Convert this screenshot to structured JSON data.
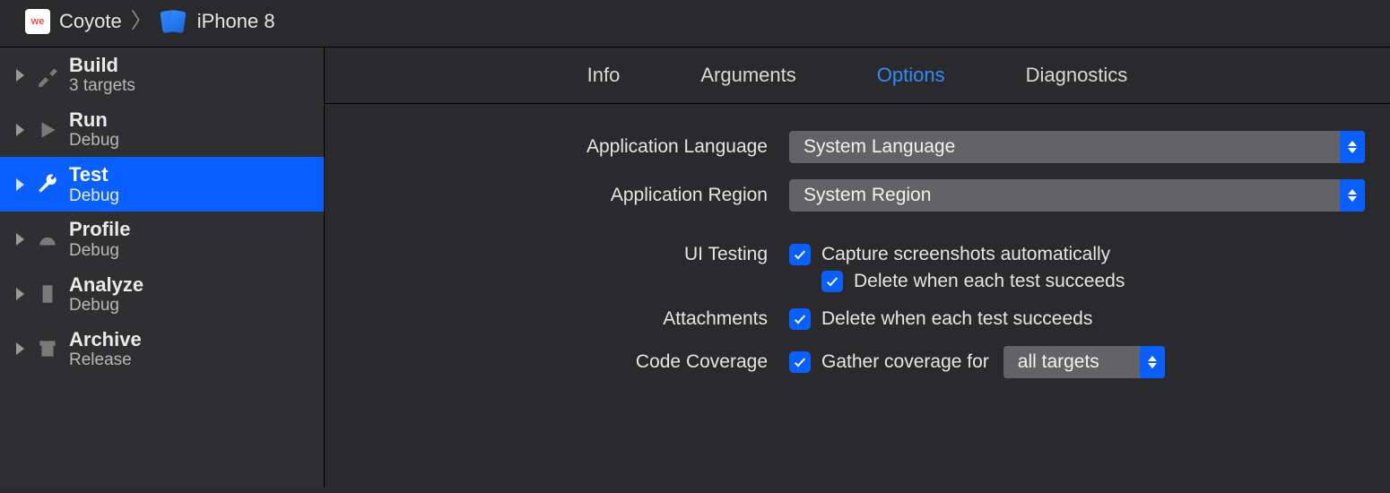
{
  "breadcrumb": {
    "project": "Coyote",
    "device": "iPhone 8"
  },
  "sidebar": {
    "items": [
      {
        "title": "Build",
        "sub": "3 targets"
      },
      {
        "title": "Run",
        "sub": "Debug"
      },
      {
        "title": "Test",
        "sub": "Debug"
      },
      {
        "title": "Profile",
        "sub": "Debug"
      },
      {
        "title": "Analyze",
        "sub": "Debug"
      },
      {
        "title": "Archive",
        "sub": "Release"
      }
    ]
  },
  "tabs": {
    "info": "Info",
    "arguments": "Arguments",
    "options": "Options",
    "diagnostics": "Diagnostics"
  },
  "options": {
    "language_label": "Application Language",
    "language_value": "System Language",
    "region_label": "Application Region",
    "region_value": "System Region",
    "uitesting_label": "UI Testing",
    "uitesting_capture": "Capture screenshots automatically",
    "uitesting_delete": "Delete when each test succeeds",
    "attachments_label": "Attachments",
    "attachments_delete": "Delete when each test succeeds",
    "coverage_label": "Code Coverage",
    "coverage_gather": "Gather coverage for",
    "coverage_scope": "all targets"
  },
  "checked": {
    "uitesting_capture": true,
    "uitesting_delete": true,
    "attachments_delete": true,
    "coverage_gather": true
  }
}
